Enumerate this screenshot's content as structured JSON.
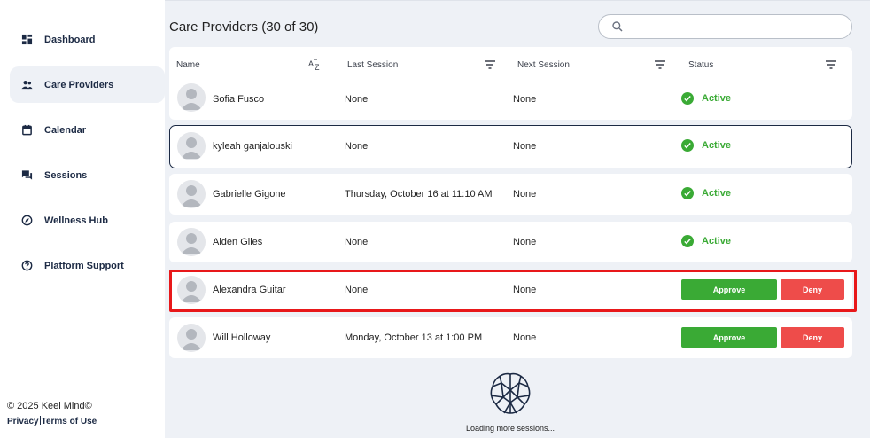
{
  "sidebar": {
    "items": [
      {
        "label": "Dashboard",
        "icon": "dashboard-icon"
      },
      {
        "label": "Care Providers",
        "icon": "people-icon",
        "active": true
      },
      {
        "label": "Calendar",
        "icon": "calendar-icon"
      },
      {
        "label": "Sessions",
        "icon": "chat-icon"
      },
      {
        "label": "Wellness Hub",
        "icon": "compass-icon"
      },
      {
        "label": "Platform Support",
        "icon": "help-icon"
      }
    ],
    "footer": {
      "copyright": "© 2025 Keel Mind©",
      "privacy": "Privacy",
      "terms": "Terms of Use"
    }
  },
  "main": {
    "title": "Care Providers (30 of 30)",
    "search": {
      "placeholder": "",
      "value": ""
    },
    "columns": {
      "name": "Name",
      "last_session": "Last Session",
      "next_session": "Next Session",
      "status": "Status"
    },
    "rows": [
      {
        "name": "Sofia Fusco",
        "last_session": "None",
        "next_session": "None",
        "status": "Active"
      },
      {
        "name": "kyleah ganjalouski",
        "last_session": "None",
        "next_session": "None",
        "status": "Active"
      },
      {
        "name": "Gabrielle Gigone",
        "last_session": "Thursday, October 16 at 11:10 AM",
        "next_session": "None",
        "status": "Active"
      },
      {
        "name": "Aiden  Giles",
        "last_session": "None",
        "next_session": "None",
        "status": "Active"
      },
      {
        "name": "Alexandra Guitar",
        "last_session": "None",
        "next_session": "None",
        "approve": "Approve",
        "deny": "Deny"
      },
      {
        "name": "Will Holloway",
        "last_session": "Monday, October 13 at 1:00 PM",
        "next_session": "None",
        "approve": "Approve",
        "deny": "Deny"
      }
    ],
    "loading_text": "Loading more sessions..."
  },
  "colors": {
    "active_green": "#3aaa35",
    "deny_red": "#ee4c4a",
    "highlight_red": "#e8181a",
    "navy": "#1c2a44",
    "background": "#eef1f6"
  }
}
